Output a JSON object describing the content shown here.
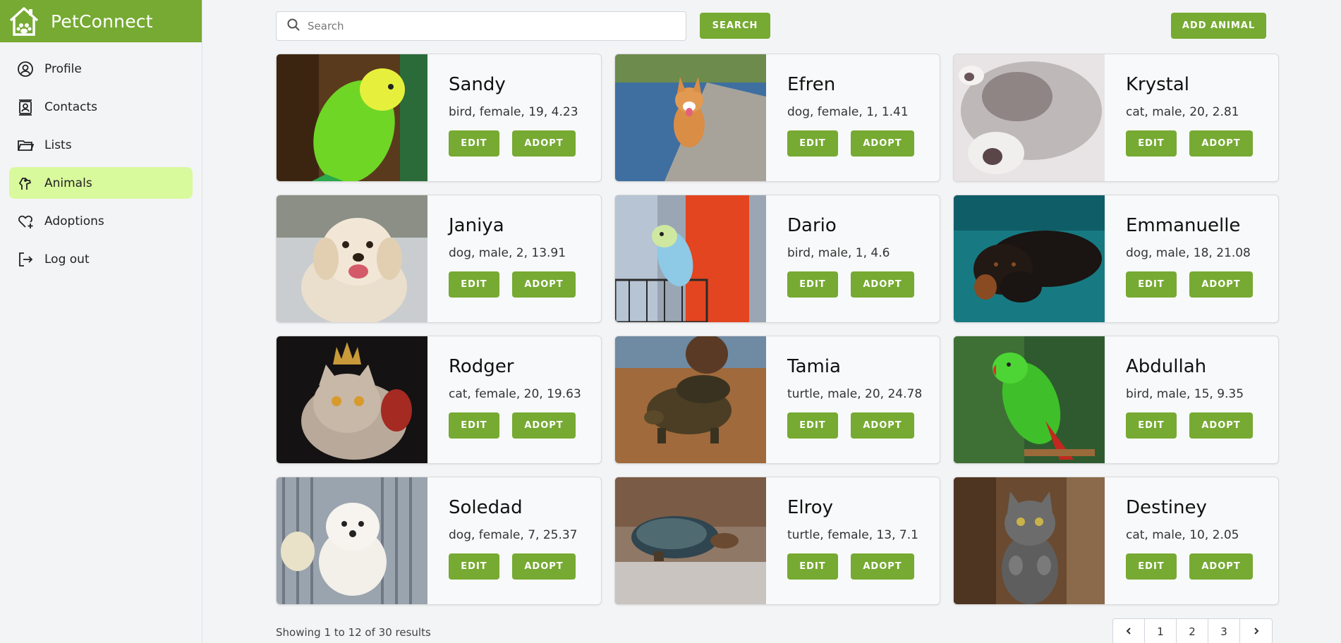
{
  "app": {
    "name": "PetConnect"
  },
  "sidebar": {
    "items": [
      {
        "label": "Profile",
        "icon": "user-circle-icon",
        "active": false
      },
      {
        "label": "Contacts",
        "icon": "contacts-icon",
        "active": false
      },
      {
        "label": "Lists",
        "icon": "folder-icon",
        "active": false
      },
      {
        "label": "Animals",
        "icon": "paw-icon",
        "active": true
      },
      {
        "label": "Adoptions",
        "icon": "heart-plus-icon",
        "active": false
      },
      {
        "label": "Log out",
        "icon": "logout-icon",
        "active": false
      }
    ]
  },
  "search": {
    "placeholder": "Search",
    "value": "",
    "button_label": "SEARCH"
  },
  "toolbar": {
    "add_label": "ADD ANIMAL"
  },
  "animals": [
    {
      "name": "Sandy",
      "details": "bird, female, 19, 4.23",
      "edit_label": "EDIT",
      "adopt_label": "ADOPT"
    },
    {
      "name": "Efren",
      "details": "dog, female, 1, 1.41",
      "edit_label": "EDIT",
      "adopt_label": "ADOPT"
    },
    {
      "name": "Krystal",
      "details": "cat, male, 20, 2.81",
      "edit_label": "EDIT",
      "adopt_label": "ADOPT"
    },
    {
      "name": "Janiya",
      "details": "dog, male, 2, 13.91",
      "edit_label": "EDIT",
      "adopt_label": "ADOPT"
    },
    {
      "name": "Dario",
      "details": "bird, male, 1, 4.6",
      "edit_label": "EDIT",
      "adopt_label": "ADOPT"
    },
    {
      "name": "Emmanuelle",
      "details": "dog, male, 18, 21.08",
      "edit_label": "EDIT",
      "adopt_label": "ADOPT"
    },
    {
      "name": "Rodger",
      "details": "cat, female, 20, 19.63",
      "edit_label": "EDIT",
      "adopt_label": "ADOPT"
    },
    {
      "name": "Tamia",
      "details": "turtle, male, 20, 24.78",
      "edit_label": "EDIT",
      "adopt_label": "ADOPT"
    },
    {
      "name": "Abdullah",
      "details": "bird, male, 15, 9.35",
      "edit_label": "EDIT",
      "adopt_label": "ADOPT"
    },
    {
      "name": "Soledad",
      "details": "dog, female, 7, 25.37",
      "edit_label": "EDIT",
      "adopt_label": "ADOPT"
    },
    {
      "name": "Elroy",
      "details": "turtle, female, 13, 7.1",
      "edit_label": "EDIT",
      "adopt_label": "ADOPT"
    },
    {
      "name": "Destiney",
      "details": "cat, male, 10, 2.05",
      "edit_label": "EDIT",
      "adopt_label": "ADOPT"
    }
  ],
  "footer": {
    "results_text": "Showing 1 to 12 of 30 results"
  },
  "pagination": {
    "prev_icon": "chevron-left-icon",
    "pages": [
      "1",
      "2",
      "3"
    ],
    "next_icon": "chevron-right-icon"
  },
  "colors": {
    "brand": "#76aa32",
    "active_nav": "#d9f99d",
    "background": "#f3f4f6"
  }
}
